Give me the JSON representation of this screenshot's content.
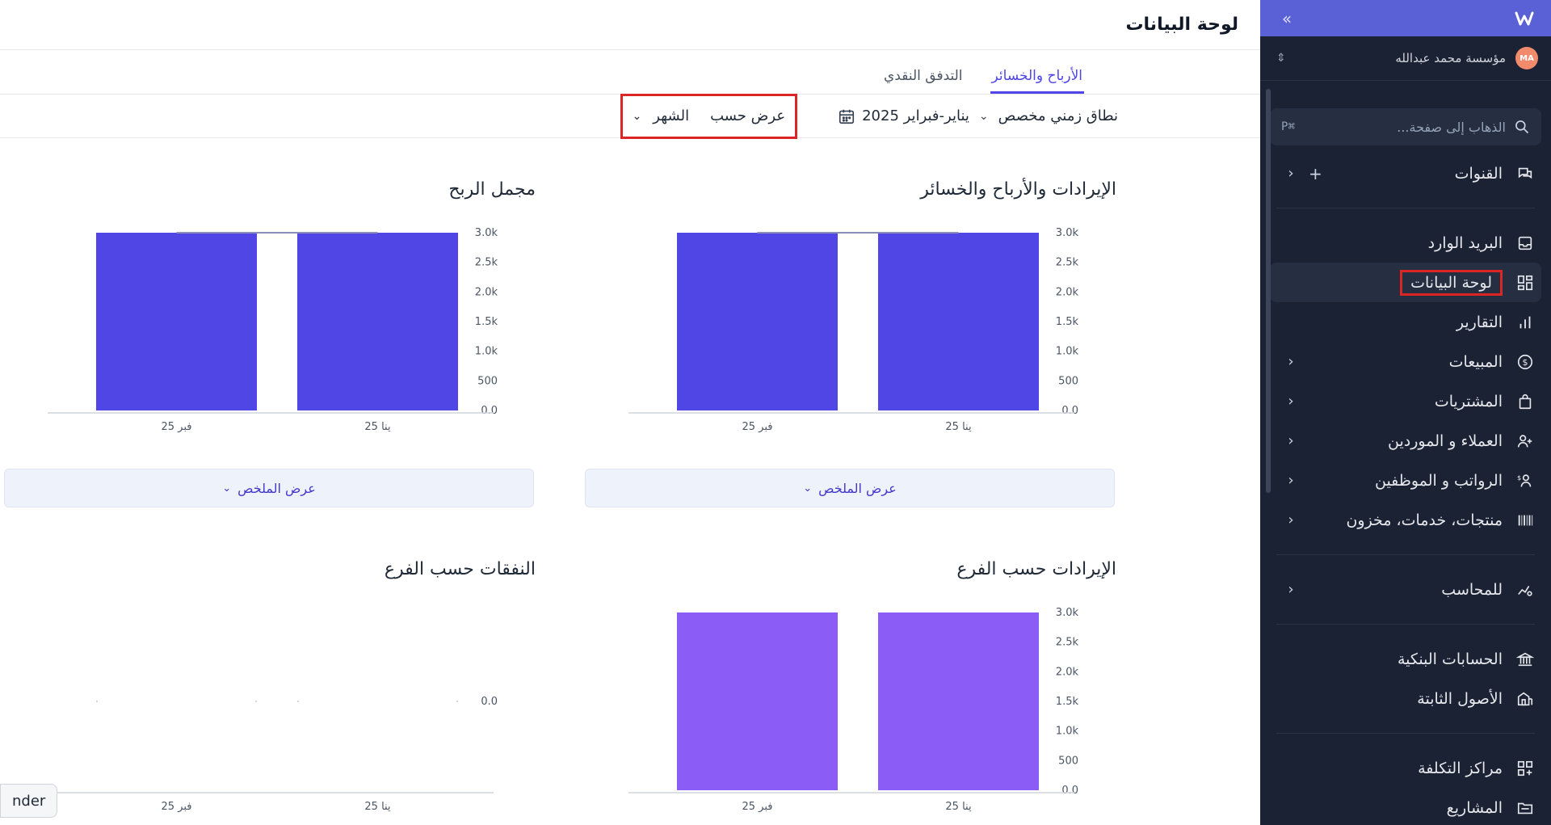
{
  "sidebar": {
    "collapse_icon": "»",
    "org_avatar": "MA",
    "org_name": "مؤسسة محمد عبدالله",
    "search": {
      "placeholder": "الذهاب إلى صفحة...",
      "shortcut": "⌘P"
    },
    "items": [
      {
        "label": "القنوات",
        "icon": "chat-icon",
        "has_plus": true,
        "has_chevron": true
      },
      {
        "label": "البريد الوارد",
        "icon": "inbox-icon"
      },
      {
        "label": "لوحة البيانات",
        "icon": "dashboard-icon",
        "active": true
      },
      {
        "label": "التقارير",
        "icon": "bar-chart-icon"
      },
      {
        "label": "المبيعات",
        "icon": "dollar-icon",
        "has_chevron": true
      },
      {
        "label": "المشتريات",
        "icon": "shopping-bag-icon",
        "has_chevron": true
      },
      {
        "label": "العملاء و الموردين",
        "icon": "users-icon",
        "has_chevron": true
      },
      {
        "label": "الرواتب و الموظفين",
        "icon": "payroll-icon",
        "has_chevron": true
      },
      {
        "label": "منتجات، خدمات، مخزون",
        "icon": "barcode-icon",
        "has_chevron": true
      },
      {
        "label": "للمحاسب",
        "icon": "accountant-icon",
        "has_chevron": true
      },
      {
        "label": "الحسابات البنكية",
        "icon": "bank-icon"
      },
      {
        "label": "الأصول الثابتة",
        "icon": "building-icon"
      },
      {
        "label": "مراكز التكلفة",
        "icon": "grid-plus-icon"
      },
      {
        "label": "المشاريع",
        "icon": "folder-icon"
      }
    ]
  },
  "header": {
    "title": "لوحة البيانات"
  },
  "tabs": [
    {
      "label": "الأرباح والخسائر",
      "active": true
    },
    {
      "label": "التدفق النقدي",
      "active": false
    }
  ],
  "filters": {
    "range_label": "نطاق زمني مخصص",
    "date_value": "يناير-فبراير 2025",
    "group_label": "عرض حسب",
    "group_value": "الشهر"
  },
  "cards": {
    "pl": {
      "title": "الإيرادات والأرباح والخسائر",
      "summary": "عرض الملخص"
    },
    "gross": {
      "title": "مجمل الربح",
      "summary": "عرض الملخص"
    },
    "rev_branch": {
      "title": "الإيرادات حسب الفرع"
    },
    "exp_branch": {
      "title": "النفقات حسب الفرع"
    }
  },
  "tooltip_fragment": "nder",
  "colors": {
    "accent": "#4f46e5",
    "bar_primary": "#4f46e5",
    "bar_secondary": "#8b5cf6",
    "sidebar_bg": "#1b2234",
    "danger_outline": "#dc2626"
  },
  "chart_data": [
    {
      "type": "bar",
      "title": "الإيرادات والأرباح والخسائر",
      "categories": [
        "ينا 25",
        "فبر 25"
      ],
      "values": [
        3000,
        3000
      ],
      "yticks": [
        "0.0",
        "500",
        "1.0k",
        "1.5k",
        "2.0k",
        "2.5k",
        "3.0k"
      ],
      "ylim": [
        0,
        3000
      ],
      "color": "#4f46e5"
    },
    {
      "type": "bar",
      "title": "مجمل الربح",
      "categories": [
        "ينا 25",
        "فبر 25"
      ],
      "values": [
        3000,
        3000
      ],
      "yticks": [
        "0.0",
        "500",
        "1.0k",
        "1.5k",
        "2.0k",
        "2.5k",
        "3.0k"
      ],
      "ylim": [
        0,
        3000
      ],
      "color": "#4f46e5"
    },
    {
      "type": "bar",
      "title": "الإيرادات حسب الفرع",
      "categories": [
        "ينا 25",
        "فبر 25"
      ],
      "values": [
        3000,
        3000
      ],
      "yticks": [
        "0.0",
        "500",
        "1.0k",
        "1.5k",
        "2.0k",
        "2.5k",
        "3.0k"
      ],
      "ylim": [
        0,
        3000
      ],
      "color": "#8b5cf6"
    },
    {
      "type": "bar",
      "title": "النفقات حسب الفرع",
      "categories": [
        "ينا 25",
        "فبر 25"
      ],
      "values": [
        0,
        0
      ],
      "yticks": [
        "0.0"
      ],
      "ylim": [
        0,
        1
      ],
      "color": "#4f46e5"
    }
  ]
}
